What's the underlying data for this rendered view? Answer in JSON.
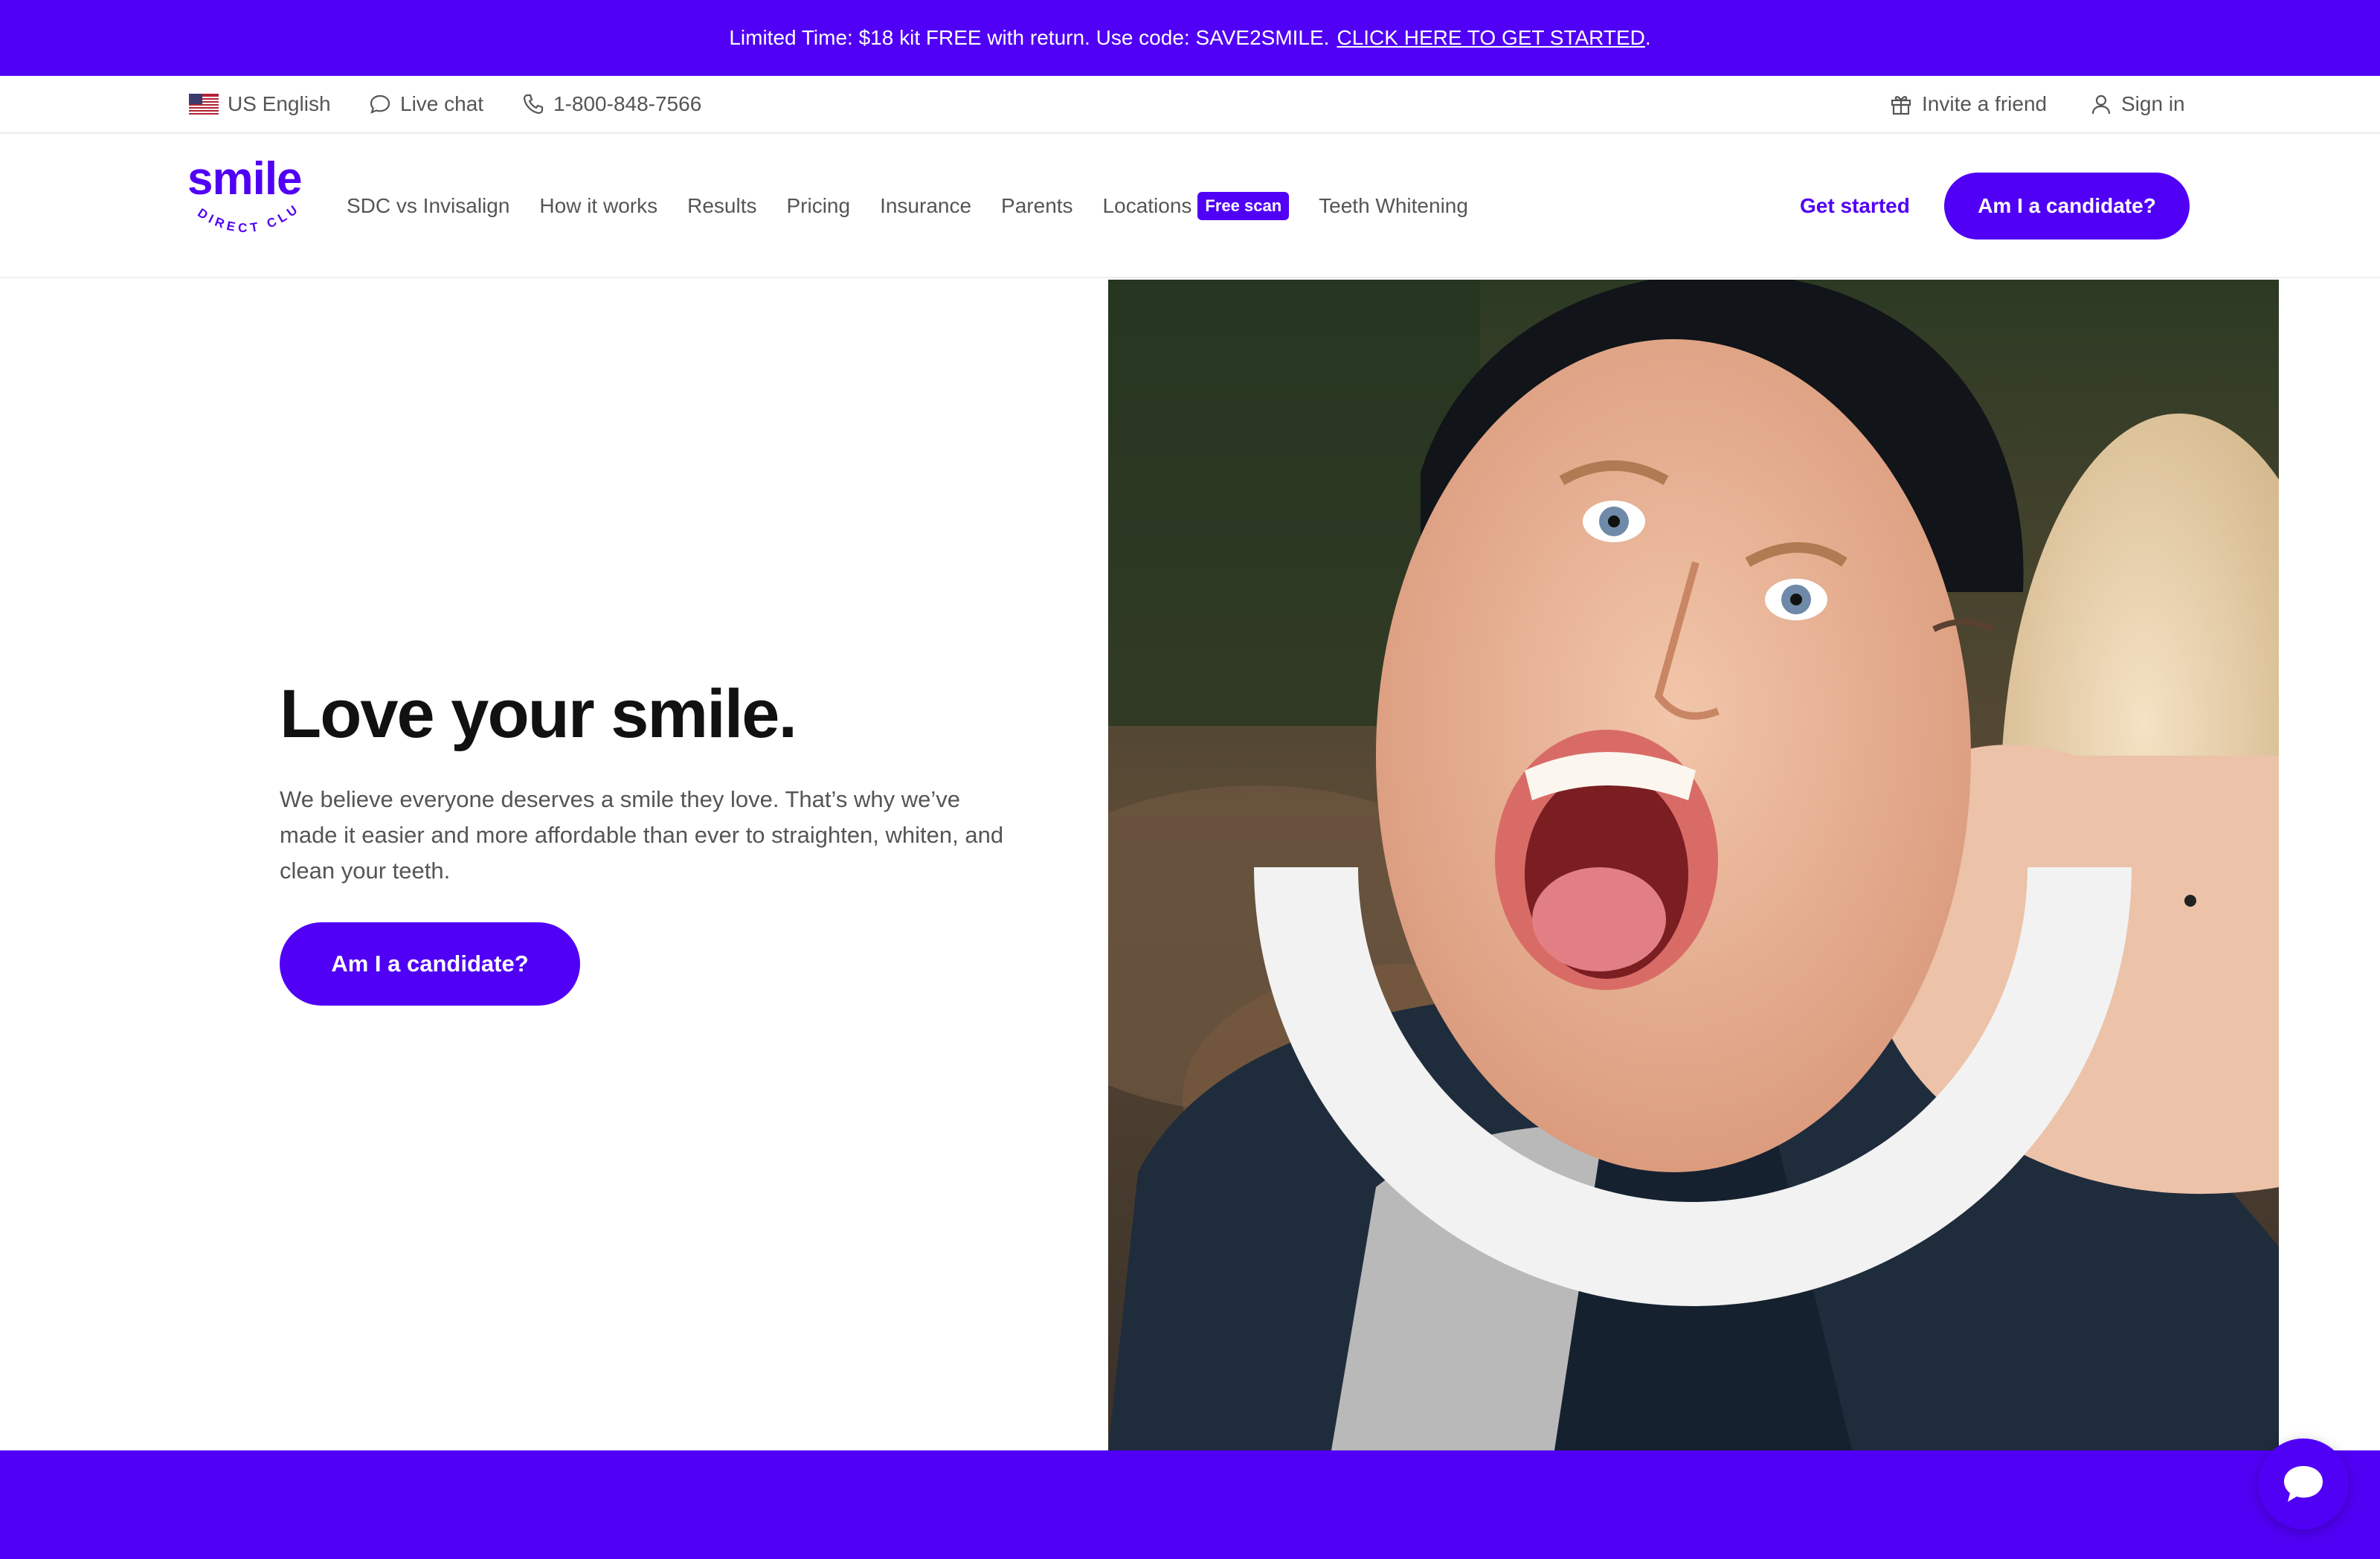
{
  "promo": {
    "text": "Limited Time: $18 kit FREE with return. Use code: SAVE2SMILE.",
    "link": "CLICK HERE TO GET STARTED",
    "trail": "."
  },
  "utility": {
    "language": "US English",
    "live_chat": "Live chat",
    "phone": "1-800-848-7566",
    "invite": "Invite a friend",
    "sign_in": "Sign in"
  },
  "logo": {
    "word": "smile",
    "sub": "DIRECT CLUB"
  },
  "nav": {
    "items": [
      "SDC vs Invisalign",
      "How it works",
      "Results",
      "Pricing",
      "Insurance",
      "Parents",
      "Locations",
      "Teeth Whitening"
    ],
    "locations_badge": "Free scan",
    "get_started": "Get started",
    "cta": "Am I a candidate?"
  },
  "hero": {
    "title": "Love your smile.",
    "body": "We believe everyone deserves a smile they love. That’s why we’ve made it easier and more affordable than ever to straighten, whiten, and clean your teeth.",
    "cta": "Am I a candidate?"
  },
  "colors": {
    "brand": "#5000f5",
    "arc": "#f2f2f2"
  },
  "icons": [
    "us-flag-icon",
    "chat-icon",
    "phone-icon",
    "gift-icon",
    "user-icon",
    "chat-bubble-icon"
  ]
}
